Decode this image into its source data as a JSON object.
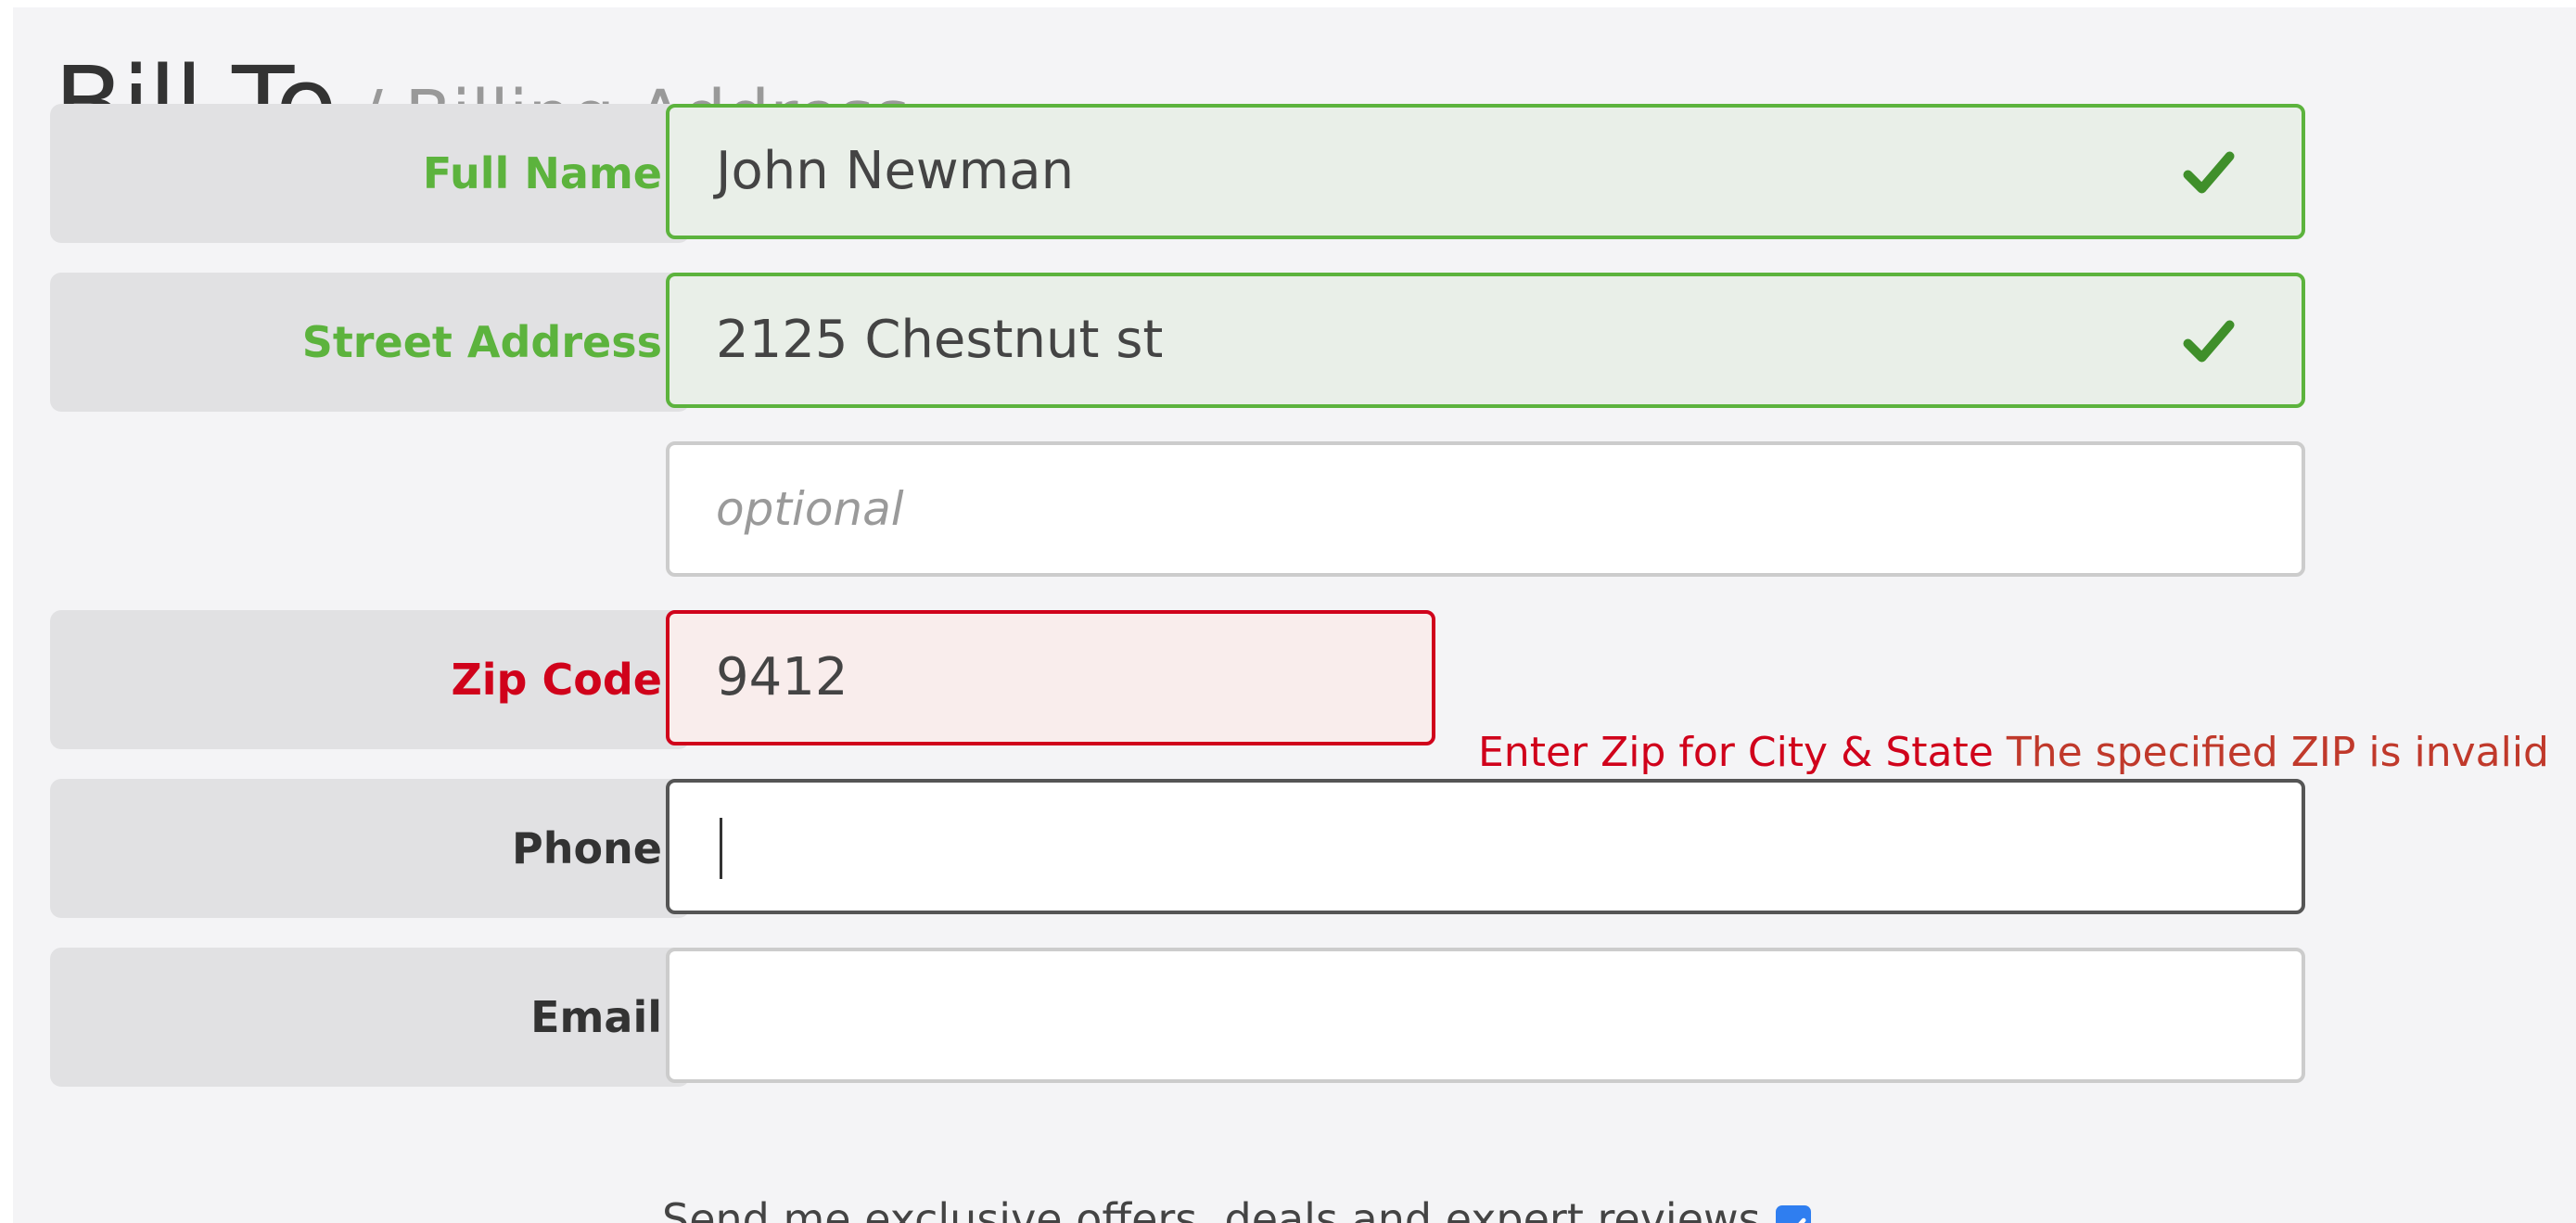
{
  "heading": {
    "title": "Bill To",
    "subtitle": "/ Billing Address"
  },
  "fields": {
    "full_name": {
      "label": "Full Name",
      "value": "John Newman",
      "status": "valid"
    },
    "street_address": {
      "label": "Street Address",
      "value": "2125 Chestnut st",
      "status": "valid"
    },
    "street_address_2": {
      "placeholder": "optional",
      "value": ""
    },
    "zip_code": {
      "label": "Zip Code",
      "value": "9412",
      "status": "invalid"
    },
    "phone": {
      "label": "Phone",
      "value": "",
      "status": "focused"
    },
    "email": {
      "label": "Email",
      "value": ""
    }
  },
  "zip_error": {
    "hint": "Enter Zip for City & State",
    "message": "The specified ZIP is invalid"
  },
  "optin": {
    "label": "Send me exclusive offers, deals and expert reviews",
    "checked": true
  },
  "icons": {
    "valid_check": "checkmark-icon",
    "optin_check": "checkbox-checked-icon"
  },
  "colors": {
    "valid": "#5cb33d",
    "invalid": "#d0021b",
    "label": "#333333",
    "subtitle": "#999999",
    "checkbox": "#2f7ef0"
  }
}
